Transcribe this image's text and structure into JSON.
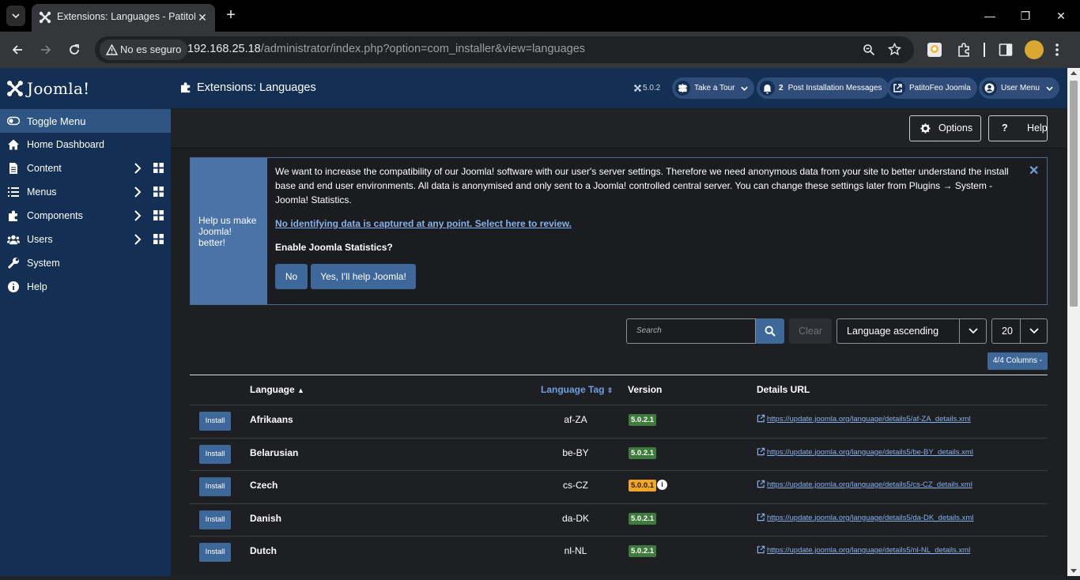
{
  "browser": {
    "tab_title": "Extensions: Languages - PatitoF",
    "security_label": "No es seguro",
    "url_host": "192.168.25.18",
    "url_path": "/administrator/index.php?option=com_installer&view=languages"
  },
  "sidebar": {
    "brand": "Joomla!",
    "toggle_label": "Toggle Menu",
    "items": [
      {
        "label": "Home Dashboard",
        "icon": "home-icon"
      },
      {
        "label": "Content",
        "icon": "file-icon"
      },
      {
        "label": "Menus",
        "icon": "list-icon"
      },
      {
        "label": "Components",
        "icon": "puzzle-icon"
      },
      {
        "label": "Users",
        "icon": "users-icon"
      },
      {
        "label": "System",
        "icon": "wrench-icon"
      },
      {
        "label": "Help",
        "icon": "info-icon"
      }
    ]
  },
  "header": {
    "title": "Extensions: Languages",
    "version": "5.0.2",
    "tour_label": "Take a Tour",
    "messages_count": "2",
    "messages_label": "Post Installation Messages",
    "site_label": "PatitoFeo Joomla",
    "user_label": "User Menu"
  },
  "toolbar": {
    "options_label": "Options",
    "help_label": "Help"
  },
  "stats": {
    "side_label": "Help us make Joomla! better!",
    "text": "We want to increase the compatibility of our Joomla! software with our user's server settings. Therefore we need anonymous data from your site to better understand the install base and end user environments. All data is anonymised and only sent to a Joomla! controlled central server. You can change these settings later from Plugins → System - Joomla! Statistics.",
    "link": "No identifying data is captured at any point. Select here to review.",
    "question": "Enable Joomla Statistics?",
    "no_label": "No",
    "yes_label": "Yes, I'll help Joomla!"
  },
  "filters": {
    "search_placeholder": "Search",
    "clear_label": "Clear",
    "ordering": "Language ascending",
    "limit": "20",
    "columns_label": "4/4 Columns -"
  },
  "table": {
    "headers": {
      "language": "Language",
      "tag": "Language Tag",
      "version": "Version",
      "details": "Details URL"
    },
    "install_label": "Install",
    "rows": [
      {
        "language": "Afrikaans",
        "tag": "af-ZA",
        "version": "5.0.2.1",
        "status": "ok",
        "url": "https://update.joomla.org/language/details5/af-ZA_details.xml"
      },
      {
        "language": "Belarusian",
        "tag": "be-BY",
        "version": "5.0.2.1",
        "status": "ok",
        "url": "https://update.joomla.org/language/details5/be-BY_details.xml"
      },
      {
        "language": "Czech",
        "tag": "cs-CZ",
        "version": "5.0.0.1",
        "status": "warn",
        "url": "https://update.joomla.org/language/details5/cs-CZ_details.xml"
      },
      {
        "language": "Danish",
        "tag": "da-DK",
        "version": "5.0.2.1",
        "status": "ok",
        "url": "https://update.joomla.org/language/details5/da-DK_details.xml"
      },
      {
        "language": "Dutch",
        "tag": "nl-NL",
        "version": "5.0.2.1",
        "status": "ok",
        "url": "https://update.joomla.org/language/details5/nl-NL_details.xml"
      }
    ]
  },
  "colors": {
    "sidebar_bg": "#132f53",
    "accent": "#3d6899",
    "ok_badge": "#3e7b3c",
    "warn_badge": "#f5a623",
    "link": "#86b1ec"
  }
}
